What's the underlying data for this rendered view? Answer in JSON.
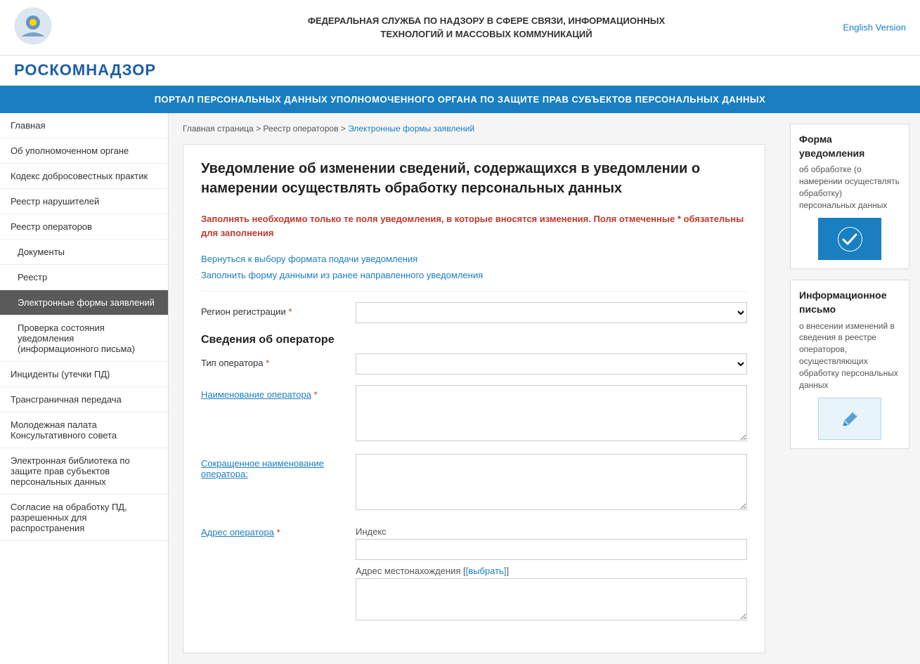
{
  "header": {
    "title_line1": "ФЕДЕРАЛЬНАЯ СЛУЖБА ПО НАДЗОРУ В СФЕРЕ СВЯЗИ, ИНФОРМАЦИОННЫХ",
    "title_line2": "ТЕХНОЛОГИЙ И МАССОВЫХ КОММУНИКАЦИЙ",
    "english_link": "English Version"
  },
  "brand": {
    "name": "РОСКОМНАДЗОР"
  },
  "portal_bar": {
    "text": "ПОРТАЛ ПЕРСОНАЛЬНЫХ ДАННЫХ УПОЛНОМОЧЕННОГО ОРГАНА ПО ЗАЩИТЕ ПРАВ СУБЪЕКТОВ ПЕРСОНАЛЬНЫХ ДАННЫХ"
  },
  "sidebar": {
    "items": [
      {
        "label": "Главная",
        "active": false,
        "sub": false
      },
      {
        "label": "Об уполномоченном органе",
        "active": false,
        "sub": false
      },
      {
        "label": "Кодекс добросовестных практик",
        "active": false,
        "sub": false
      },
      {
        "label": "Реестр нарушителей",
        "active": false,
        "sub": false
      },
      {
        "label": "Реестр операторов",
        "active": false,
        "sub": false
      },
      {
        "label": "Документы",
        "active": false,
        "sub": true
      },
      {
        "label": "Реестр",
        "active": false,
        "sub": true
      },
      {
        "label": "Электронные формы заявлений",
        "active": true,
        "sub": true
      },
      {
        "label": "Проверка состояния уведомления (информационного письма)",
        "active": false,
        "sub": true
      },
      {
        "label": "Инциденты (утечки ПД)",
        "active": false,
        "sub": false
      },
      {
        "label": "Трансграничная передача",
        "active": false,
        "sub": false
      },
      {
        "label": "Молодежная палата Консультативного совета",
        "active": false,
        "sub": false
      },
      {
        "label": "Электронная библиотека по защите прав субъектов персональных данных",
        "active": false,
        "sub": false
      },
      {
        "label": "Согласие на обработку ПД, разрешенных для распространения",
        "active": false,
        "sub": false
      }
    ]
  },
  "breadcrumb": {
    "parts": [
      {
        "label": "Главная страница",
        "link": true
      },
      {
        "label": "Реестр операторов",
        "link": true
      },
      {
        "label": "Электронные формы заявлений",
        "link": false
      }
    ],
    "separator": " > "
  },
  "page_title": "Уведомление об изменении сведений, содержащихся в уведомлении о намерении осуществлять обработку персональных данных",
  "required_note": "Заполнять необходимо только те поля уведомления, в которые вносятся изменения. Поля отмеченные * обязательны для заполнения",
  "links": {
    "return": "Вернуться к выбору формата подачи уведомления",
    "fill": "Заполнить форму данными из ранее направленного уведомления"
  },
  "form": {
    "region_label": "Регион регистрации",
    "required_mark": "*",
    "region_placeholder": "",
    "section_operator": "Сведения об операторе",
    "operator_type_label": "Тип оператора",
    "operator_name_label": "Наименование оператора",
    "operator_short_name_label": "Сокращенное наименование оператора:",
    "operator_address_label": "Адрес оператора",
    "index_label": "Индекс",
    "address_location_label": "Адрес местонахождения",
    "address_select": "[выбрать]"
  },
  "right_panel": {
    "card1": {
      "title": "Форма уведомления",
      "text": "об обработке (о намерении осуществлять обработку) персональных данных",
      "icon": "checkmark"
    },
    "card2": {
      "title": "Информационное письмо",
      "text": "о внесении изменений в сведения в реестре операторов, осуществляющих обработку персональных данных",
      "icon": "pencil"
    }
  }
}
